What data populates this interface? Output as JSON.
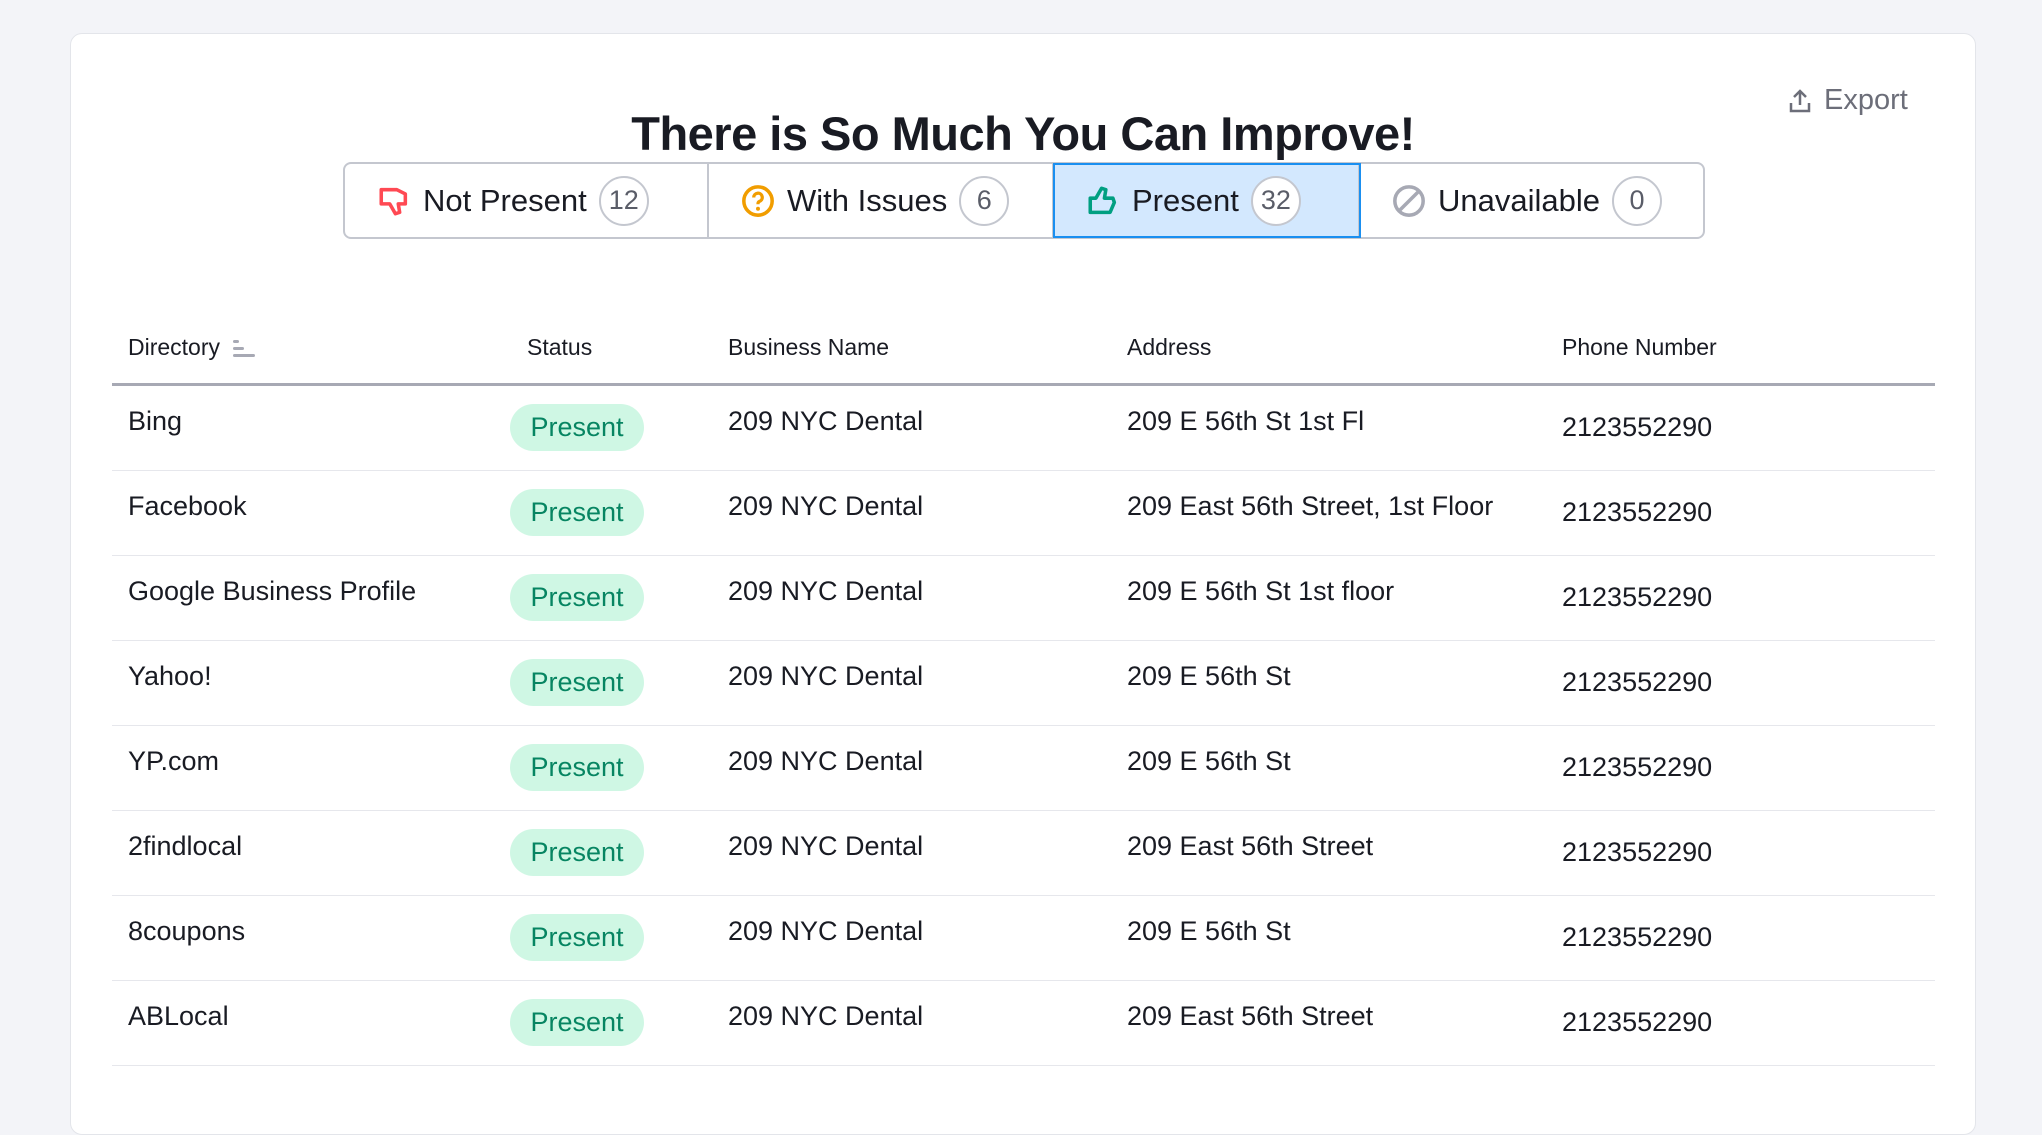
{
  "title": "There is So Much You Can Improve!",
  "export_label": "Export",
  "tabs": [
    {
      "label": "Not Present",
      "count": "12",
      "icon": "thumbs-down-icon",
      "color": "#ff4953"
    },
    {
      "label": "With Issues",
      "count": "6",
      "icon": "question-circle-icon",
      "color": "#f19d00"
    },
    {
      "label": "Present",
      "count": "32",
      "icon": "thumbs-up-icon",
      "color": "#009f81",
      "active": true
    },
    {
      "label": "Unavailable",
      "count": "0",
      "icon": "unavailable-icon",
      "color": "#a7a9b4"
    }
  ],
  "table": {
    "headers": [
      "Directory",
      "Status",
      "Business Name",
      "Address",
      "Phone Number"
    ],
    "rows": [
      {
        "directory": "Bing",
        "status": "Present",
        "name": "209 NYC Dental",
        "address": "209 E 56th St 1st Fl",
        "phone": "2123552290"
      },
      {
        "directory": "Facebook",
        "status": "Present",
        "name": "209 NYC Dental",
        "address": "209 East 56th Street, 1st Floor",
        "phone": "2123552290"
      },
      {
        "directory": "Google Business Profile",
        "status": "Present",
        "name": "209 NYC Dental",
        "address": "209 E 56th St 1st floor",
        "phone": "2123552290"
      },
      {
        "directory": "Yahoo!",
        "status": "Present",
        "name": "209 NYC Dental",
        "address": "209 E 56th St",
        "phone": "2123552290"
      },
      {
        "directory": "YP.com",
        "status": "Present",
        "name": "209 NYC Dental",
        "address": "209 E 56th St",
        "phone": "2123552290"
      },
      {
        "directory": "2findlocal",
        "status": "Present",
        "name": "209 NYC Dental",
        "address": "209 East 56th Street",
        "phone": "2123552290"
      },
      {
        "directory": "8coupons",
        "status": "Present",
        "name": "209 NYC Dental",
        "address": "209 E 56th St",
        "phone": "2123552290"
      },
      {
        "directory": "ABLocal",
        "status": "Present",
        "name": "209 NYC Dental",
        "address": "209 East 56th Street",
        "phone": "2123552290"
      }
    ]
  }
}
